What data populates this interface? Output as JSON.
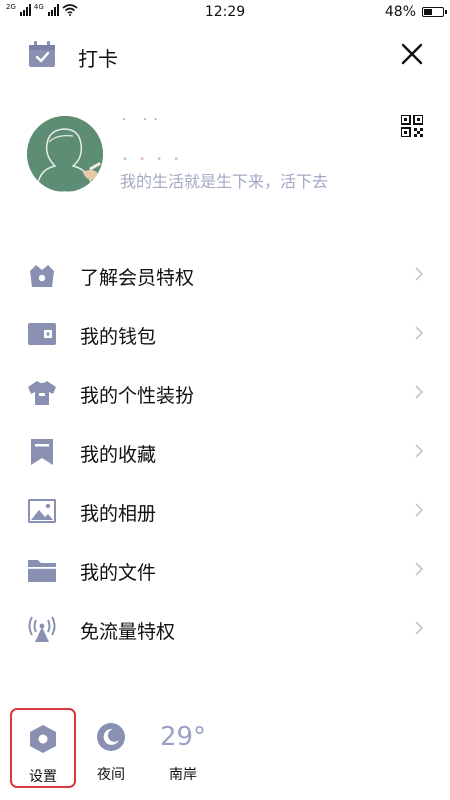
{
  "status": {
    "network_1": "2G",
    "network_2": "4G",
    "time": "12:29",
    "battery": "48%",
    "battery_fraction": 0.48
  },
  "header": {
    "title": "打卡",
    "close_icon": "close-icon",
    "calendar_icon": "calendar-check-icon"
  },
  "profile": {
    "signature": "我的生活就是生下来，活下去",
    "qr_icon": "qr-code-icon"
  },
  "menu": {
    "items": [
      {
        "label": "了解会员特权",
        "icon": "crown-icon"
      },
      {
        "label": "我的钱包",
        "icon": "wallet-icon"
      },
      {
        "label": "我的个性装扮",
        "icon": "shirt-icon"
      },
      {
        "label": "我的收藏",
        "icon": "bookmark-icon"
      },
      {
        "label": "我的相册",
        "icon": "image-icon"
      },
      {
        "label": "我的文件",
        "icon": "folder-icon"
      },
      {
        "label": "免流量特权",
        "icon": "signal-tower-icon"
      }
    ]
  },
  "bottom": {
    "settings_label": "设置",
    "night_label": "夜间",
    "temperature": "29°",
    "city": "南岸"
  },
  "colors": {
    "icon": "#9aa0bd",
    "icon_dark": "#8990b2",
    "highlight_border": "#d8383f",
    "signature_text": "#a4aac6",
    "avatar_bg": "#5d8d74"
  }
}
